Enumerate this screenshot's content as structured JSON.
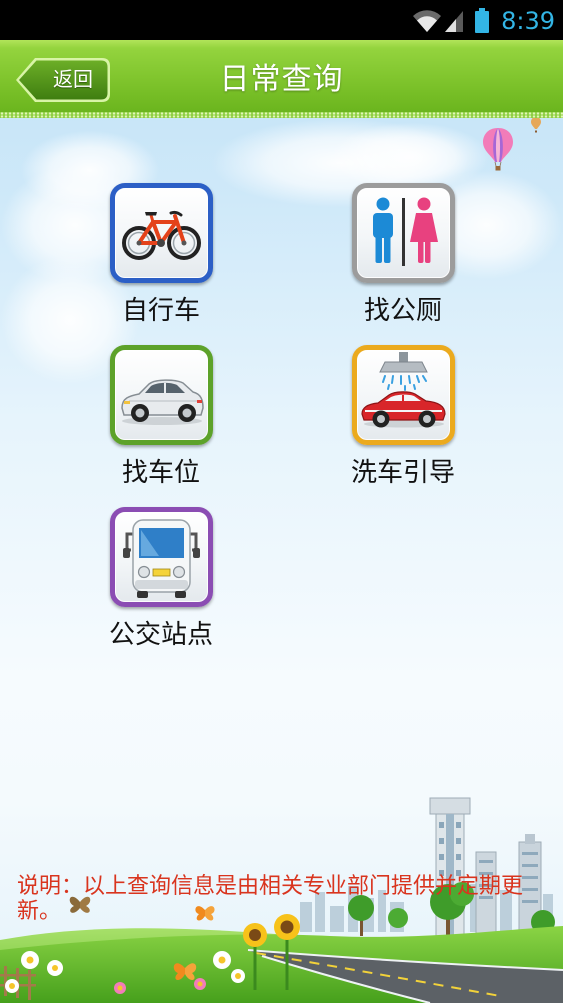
{
  "status_bar": {
    "time": "8:39",
    "time_color": "#33b5e5",
    "icons": [
      "wifi-icon",
      "signal-icon",
      "battery-icon"
    ]
  },
  "header": {
    "back_label": "返回",
    "title": "日常查询",
    "color": "#7cc22a"
  },
  "menu": [
    {
      "label": "自行车",
      "icon": "bicycle-icon",
      "border_color": "#2c5fc6"
    },
    {
      "label": "找公厕",
      "icon": "toilet-icon",
      "border_color": "#9c9c9c"
    },
    {
      "label": "找车位",
      "icon": "car-icon",
      "border_color": "#5da22a"
    },
    {
      "label": "洗车引导",
      "icon": "car-wash-icon",
      "border_color": "#ebaa1e"
    },
    {
      "label": "公交站点",
      "icon": "bus-icon",
      "border_color": "#8b4db3"
    }
  ],
  "note": {
    "text": "说明：以上查询信息是由相关专业部门提供并定期更新。",
    "color": "#d9341e"
  }
}
